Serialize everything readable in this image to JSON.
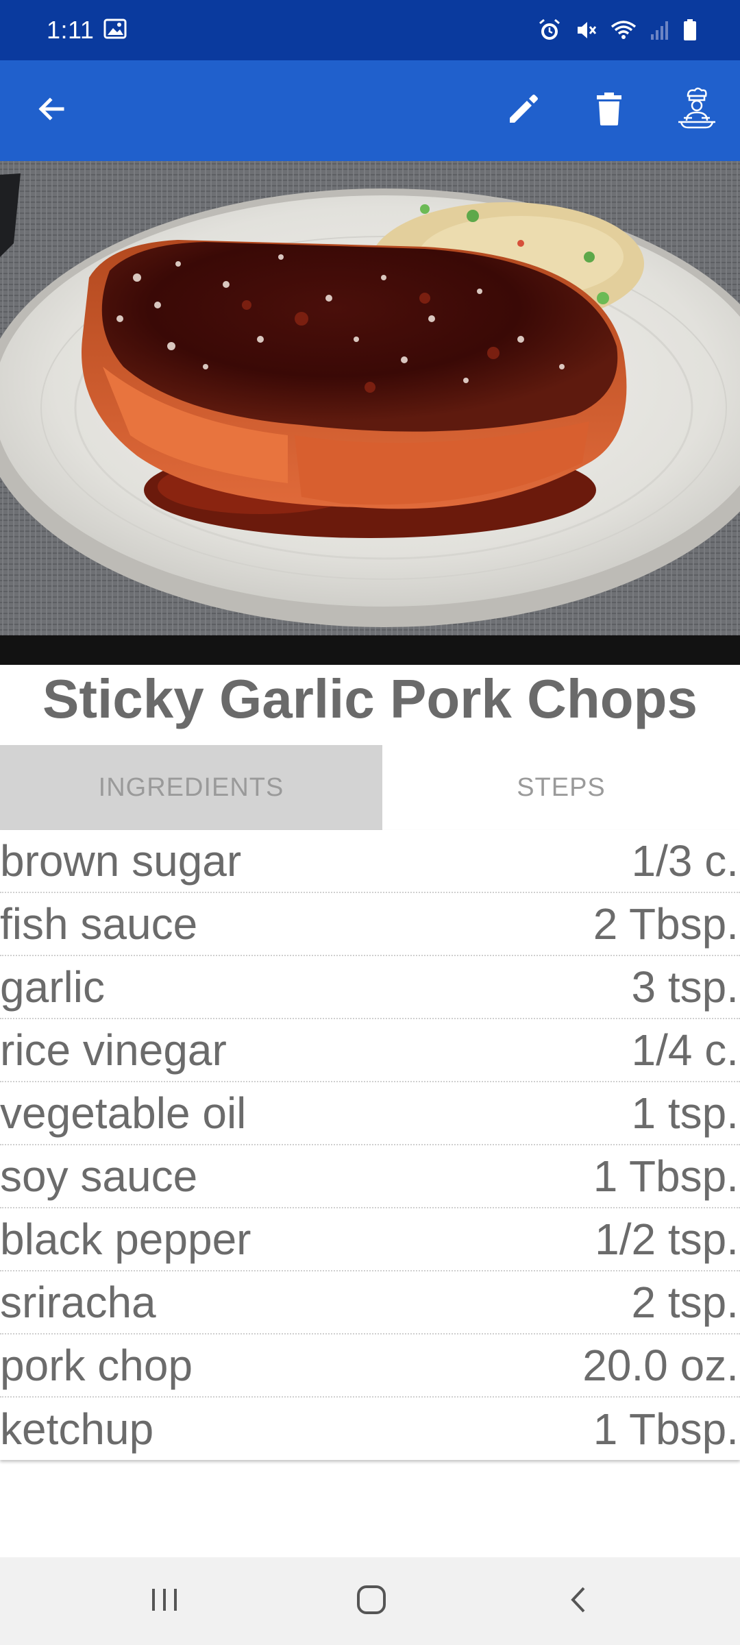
{
  "status_bar": {
    "time": "1:11",
    "icons": [
      "gallery-icon",
      "alarm-icon",
      "mute-icon",
      "wifi-icon",
      "signal-icon",
      "battery-icon"
    ]
  },
  "app_bar": {
    "background": "#2060cc",
    "icons": [
      "back-arrow-icon",
      "edit-pencil-icon",
      "delete-trash-icon",
      "chef-cooking-icon"
    ]
  },
  "hero_image": {
    "description_icon": "food-photo"
  },
  "recipe": {
    "title": "Sticky Garlic Pork Chops"
  },
  "tabs": [
    {
      "label": "INGREDIENTS",
      "selected": true
    },
    {
      "label": "STEPS",
      "selected": false
    }
  ],
  "ingredients": [
    {
      "name": "brown sugar",
      "qty": "1/3 c."
    },
    {
      "name": "fish sauce",
      "qty": "2 Tbsp."
    },
    {
      "name": "garlic",
      "qty": "3 tsp."
    },
    {
      "name": "rice vinegar",
      "qty": "1/4 c."
    },
    {
      "name": "vegetable oil",
      "qty": "1 tsp."
    },
    {
      "name": "soy sauce",
      "qty": "1 Tbsp."
    },
    {
      "name": "black pepper",
      "qty": "1/2 tsp."
    },
    {
      "name": "sriracha",
      "qty": "2 tsp."
    },
    {
      "name": "pork chop",
      "qty": "20.0 oz."
    },
    {
      "name": "ketchup",
      "qty": "1 Tbsp."
    }
  ],
  "nav_bar": {
    "icons": [
      "recent-apps-icon",
      "home-icon",
      "back-icon"
    ]
  }
}
